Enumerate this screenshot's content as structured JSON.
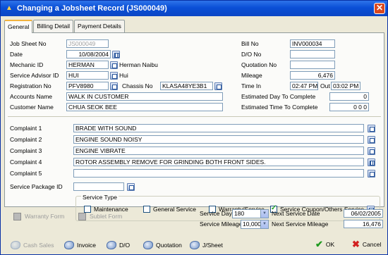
{
  "window": {
    "title": "Changing a Jobsheet Record  (JS000049)",
    "close": "✕"
  },
  "tabs": [
    "General",
    "Billing Detail",
    "Payment Details"
  ],
  "left": {
    "job_sheet_no": {
      "label": "Job Sheet No",
      "value": "JS000049"
    },
    "date": {
      "label": "Date",
      "value": "10/08/2004"
    },
    "mechanic": {
      "label": "Mechanic ID",
      "value": "HERMAN",
      "name": "Herman Naibu"
    },
    "advisor": {
      "label": "Service Advisor ID",
      "value": "HUI",
      "name": "Hui"
    },
    "registration": {
      "label": "Registration No",
      "value": "PFV8980"
    },
    "chassis": {
      "label": "Chassis No",
      "value": "KLASA48YE3B1"
    },
    "accounts": {
      "label": "Accounts Name",
      "value": "WALK IN CUSTOMER"
    },
    "customer": {
      "label": "Customer Name",
      "value": "CHUA SEOK BEE"
    }
  },
  "right": {
    "bill_no": {
      "label": "Bill No",
      "value": "INV000034"
    },
    "do_no": {
      "label": "D/O No",
      "value": ""
    },
    "quotation_no": {
      "label": "Quotation No",
      "value": ""
    },
    "mileage": {
      "label": "Mileage",
      "value": "6,476"
    },
    "time_in": {
      "label": "Time In",
      "value": "02:47 PM",
      "out_label": "Out",
      "out_value": "03:02 PM"
    },
    "est_day": {
      "label": "Estimated Day To Complete",
      "value": "0"
    },
    "est_time": {
      "label": "Estimated Time To Complete",
      "value": "0 0 0"
    }
  },
  "complaints": [
    {
      "label": "Complaint 1",
      "value": "BRADE WITH SOUND"
    },
    {
      "label": "Complaint 2",
      "value": "ENGINE SOUND NOISY"
    },
    {
      "label": "Complaint 3",
      "value": "ENGINE  VIBRATE"
    },
    {
      "label": "Complaint 4",
      "value": "ROTOR ASSEMBLY REMOVE FOR GRINDING BOTH FRONT SIDES."
    },
    {
      "label": "Complaint 5",
      "value": ""
    }
  ],
  "service_package": {
    "label": "Service Package ID",
    "value": ""
  },
  "service_type": {
    "label": "Service Type",
    "options": [
      {
        "label": "Maintenance",
        "checked": false
      },
      {
        "label": "General Service",
        "checked": false
      },
      {
        "label": "Warranty/Service",
        "checked": false
      },
      {
        "label": "Service Coupon/Others Service",
        "checked": true
      }
    ]
  },
  "footer": {
    "warranty_form": "Warranty Form",
    "sublet_form": "Sublet Form",
    "service_day": {
      "label": "Service Day",
      "value": "180"
    },
    "service_mileage": {
      "label": "Service Mileage",
      "value": "10,000"
    },
    "next_date": {
      "label": "Next Service Date",
      "value": "06/02/2005"
    },
    "next_mileage": {
      "label": "Next Service Mileage",
      "value": "16,476"
    }
  },
  "buttons": {
    "cash_sales": "Cash Sales",
    "invoice": "Invoice",
    "do": "D/O",
    "quotation": "Quotation",
    "jsheet": "J/Sheet",
    "ok": "OK",
    "cancel": "Cancel"
  }
}
